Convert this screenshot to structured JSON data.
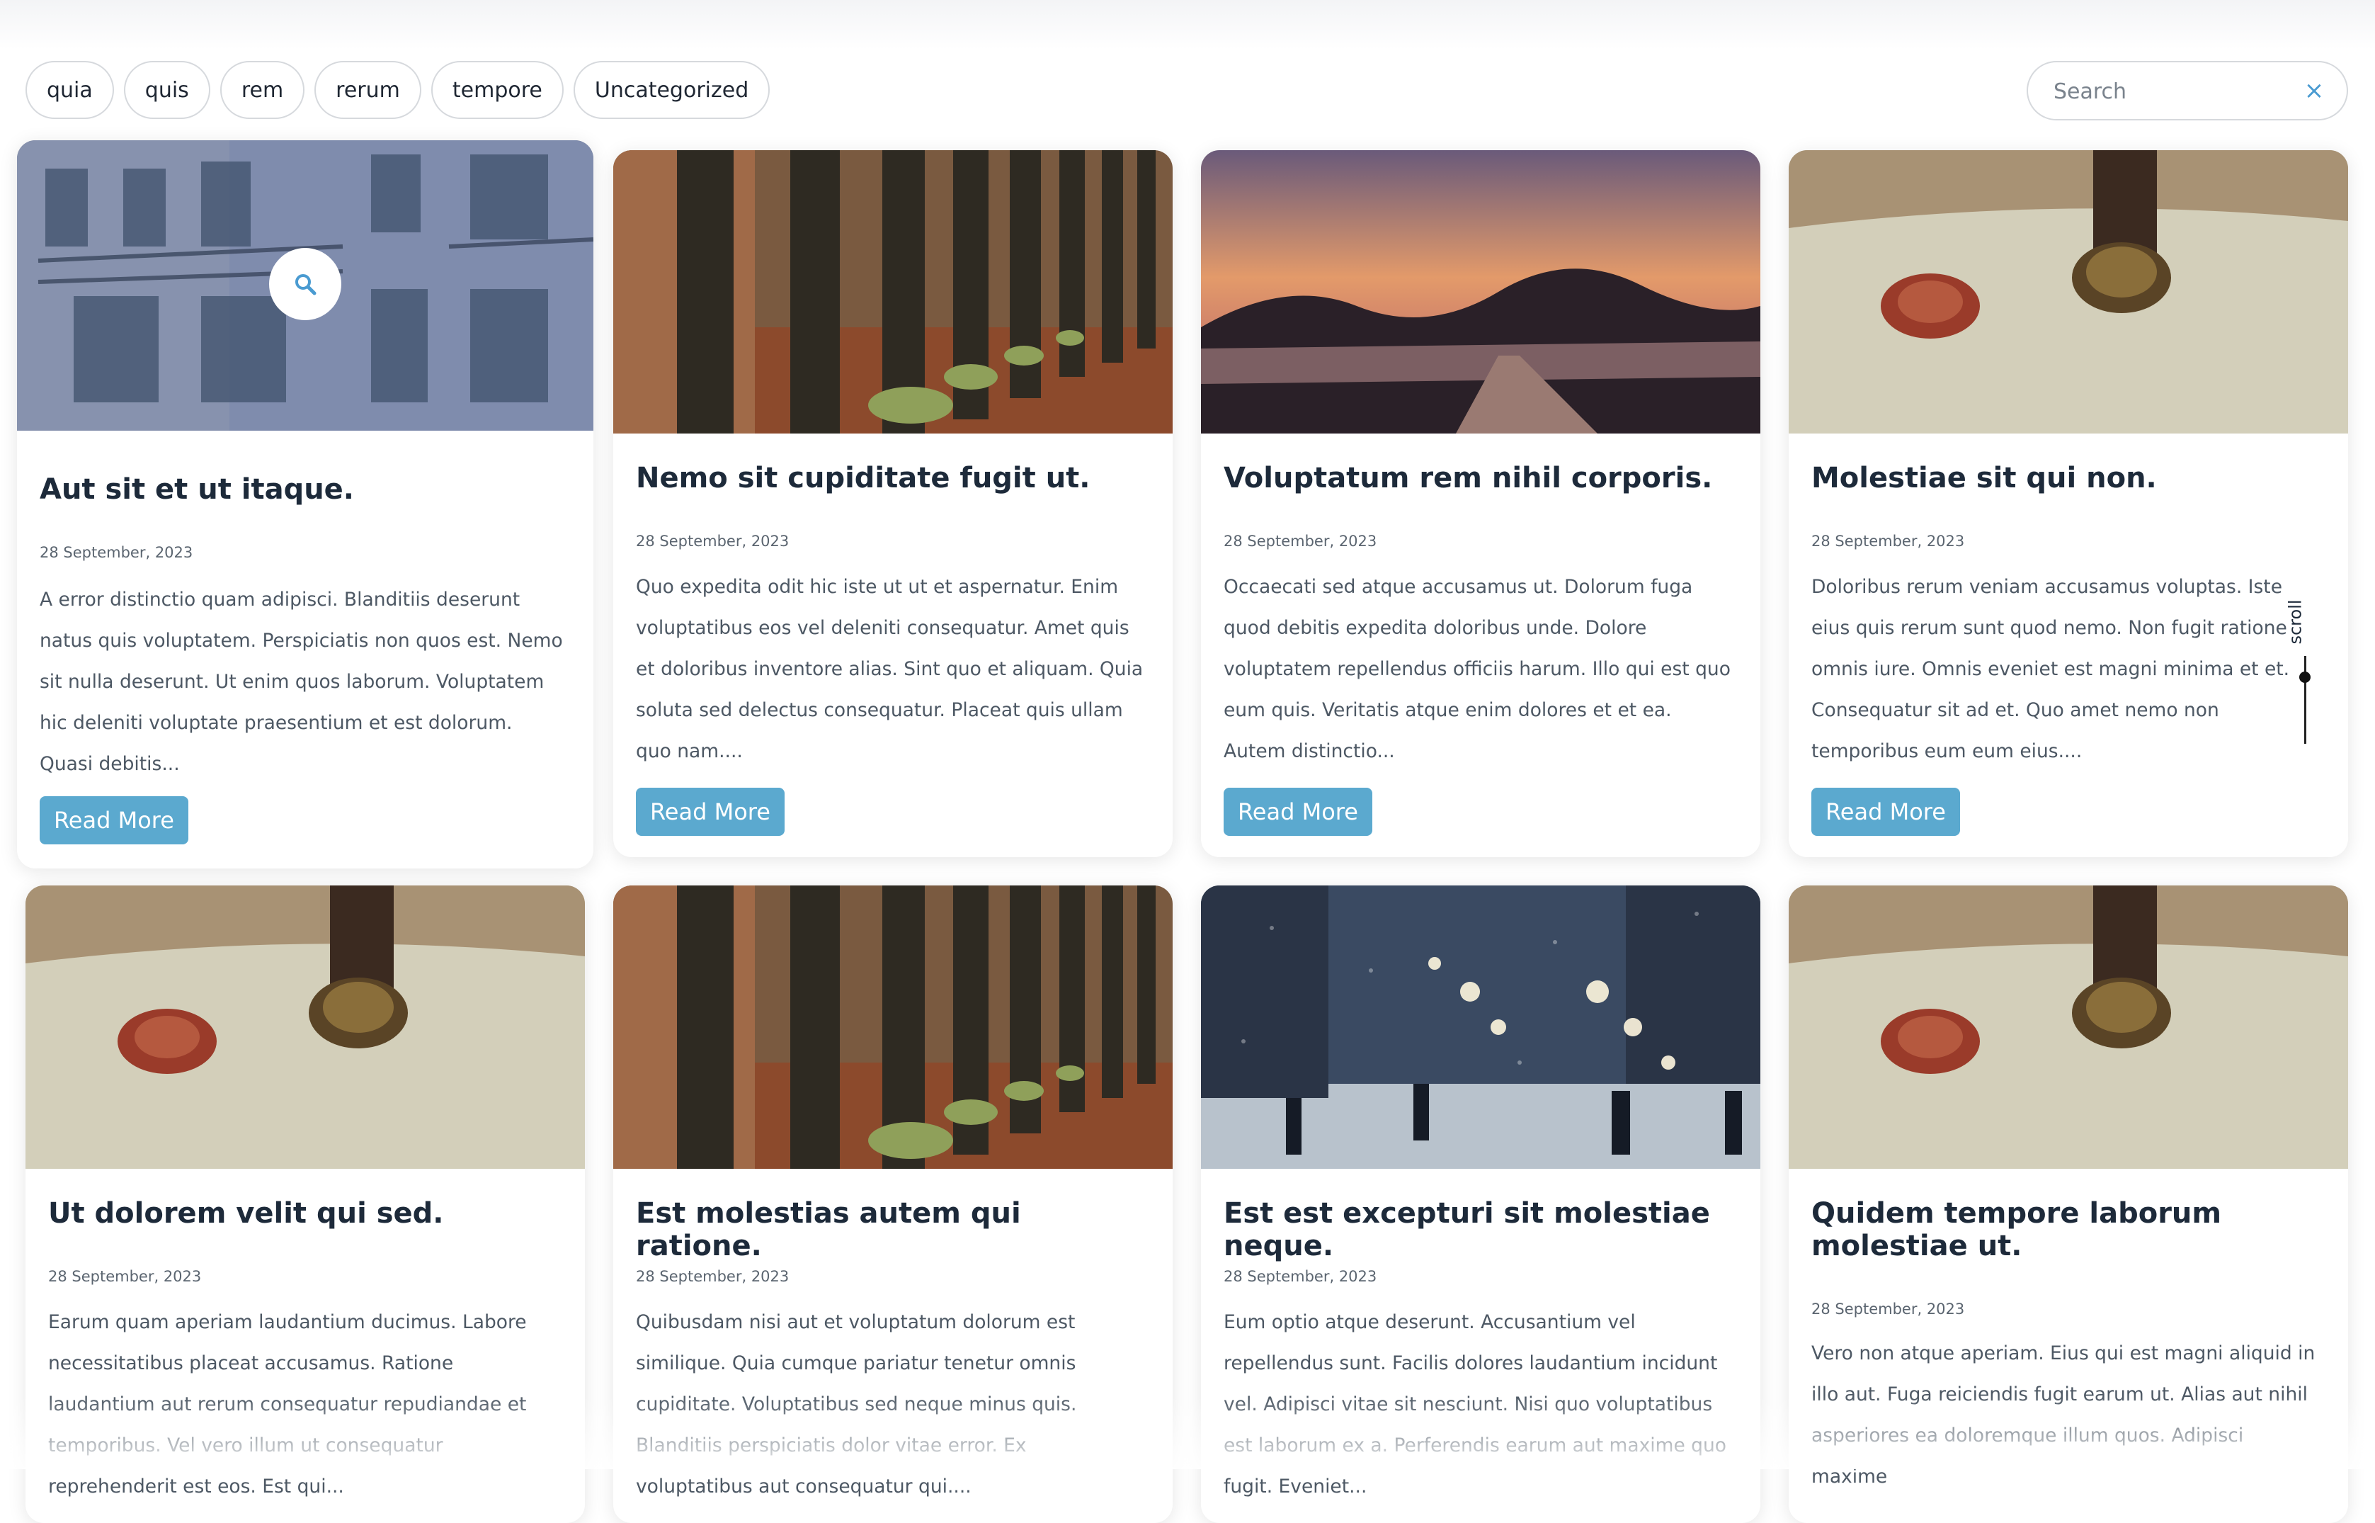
{
  "categories": [
    "quia",
    "quis",
    "rem",
    "rerum",
    "tempore",
    "Uncategorized"
  ],
  "search": {
    "placeholder": "Search",
    "clear_icon": "close-icon"
  },
  "scroll_label": "scroll",
  "read_more": "Read More",
  "posts": [
    {
      "title": "Aut sit et ut itaque.",
      "date": "28 September, 2023",
      "excerpt": "A error distinctio quam adipisci. Blanditiis deserunt natus quis voluptatem. Perspiciatis non quos est. Nemo sit nulla deserunt. Ut enim quos laborum. Voluptatem hic deleniti voluptate praesentium et est dolorum. Quasi debitis...",
      "image": "building-facade"
    },
    {
      "title": "Nemo sit cupiditate fugit ut.",
      "date": "28 September, 2023",
      "excerpt": "Quo expedita odit hic iste ut ut et aspernatur. Enim voluptatibus eos vel deleniti consequatur. Amet quis et doloribus inventore alias. Sint quo et aliquam. Quia soluta sed delectus consequatur. Placeat quis ullam quo nam....",
      "image": "wooden-fence"
    },
    {
      "title": "Voluptatum rem nihil corporis.",
      "date": "28 September, 2023",
      "excerpt": "Occaecati sed atque accusamus ut. Dolorum fuga quod debitis expedita doloribus unde. Dolore voluptatem repellendus officiis harum. Illo qui est quo eum quis. Veritatis atque enim dolores et et ea. Autem distinctio...",
      "image": "misty-sunset-path"
    },
    {
      "title": "Molestiae sit qui non.",
      "date": "28 September, 2023",
      "excerpt": "Doloribus rerum veniam accusamus voluptas. Iste eius quis rerum sunt quod nemo. Non fugit ratione omnis iure. Omnis eveniet est magni minima et et. Consequatur sit ad et. Quo amet nemo non temporibus eum eum eius....",
      "image": "wax-seal"
    },
    {
      "title": "Ut dolorem velit qui sed.",
      "date": "28 September, 2023",
      "excerpt": "Earum quam aperiam laudantium ducimus. Labore necessitatibus placeat accusamus. Ratione laudantium aut rerum consequatur repudiandae et temporibus. Vel vero illum ut consequatur reprehenderit est eos. Est qui...",
      "image": "wax-seal"
    },
    {
      "title": "Est molestias autem qui ratione.",
      "date": "28 September, 2023",
      "excerpt": "Quibusdam nisi aut et voluptatum dolorum est similique. Quia cumque pariatur tenetur omnis cupiditate. Voluptatibus sed neque minus quis. Blanditiis perspiciatis dolor vitae error. Ex voluptatibus aut consequatur qui....",
      "image": "wooden-fence"
    },
    {
      "title": "Est est excepturi sit molestiae neque.",
      "date": "28 September, 2023",
      "excerpt": "Eum optio atque deserunt. Accusantium vel repellendus sunt. Facilis dolores laudantium incidunt vel. Adipisci vitae sit nesciunt. Nisi quo voluptatibus est laborum ex a. Perferendis earum aut maxime quo fugit. Eveniet...",
      "image": "snowy-street"
    },
    {
      "title": "Quidem tempore laborum molestiae ut.",
      "date": "28 September, 2023",
      "excerpt": "Vero non atque aperiam. Eius qui est magni aliquid in illo aut. Fuga reiciendis fugit earum ut. Alias aut nihil asperiores ea doloremque illum quos. Adipisci maxime",
      "image": "wax-seal"
    }
  ]
}
